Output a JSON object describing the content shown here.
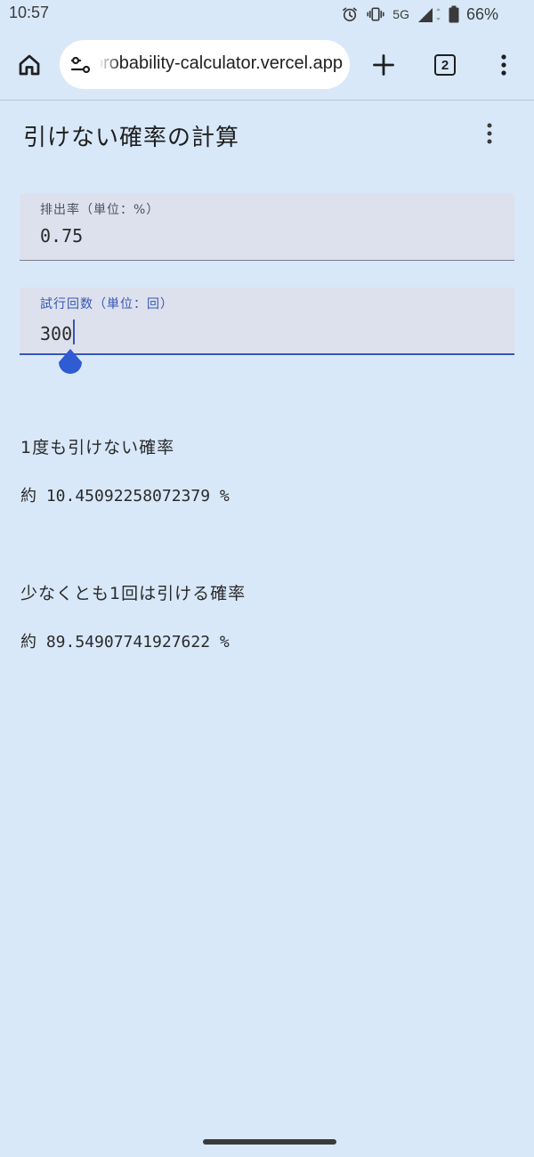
{
  "status_bar": {
    "time": "10:57",
    "network": "5G",
    "battery": "66%",
    "icons": [
      "alarm-icon",
      "vibrate-icon",
      "signal-icon",
      "battery-icon"
    ]
  },
  "browser": {
    "url": "probability-calculator.vercel.app",
    "tab_count": "2",
    "icons": [
      "home-icon",
      "site-settings-icon",
      "plus-icon",
      "tab-switcher-icon",
      "more-vert-icon"
    ]
  },
  "page": {
    "title": "引けない確率の計算",
    "fields": [
      {
        "label": "排出率（単位：%）",
        "value": "0.75"
      },
      {
        "label": "試行回数（単位：回）",
        "value": "300"
      }
    ],
    "results": [
      {
        "label": "1度も引けない確率",
        "value": "約 10.45092258072379 %"
      },
      {
        "label": "少なくとも1回は引ける確率",
        "value": "約 89.54907741927622 %"
      }
    ]
  },
  "colors": {
    "background": "#d8e8f9",
    "field_background": "#dde1ee",
    "accent": "#3656b5",
    "cursor_handle": "#2f5bd3"
  }
}
